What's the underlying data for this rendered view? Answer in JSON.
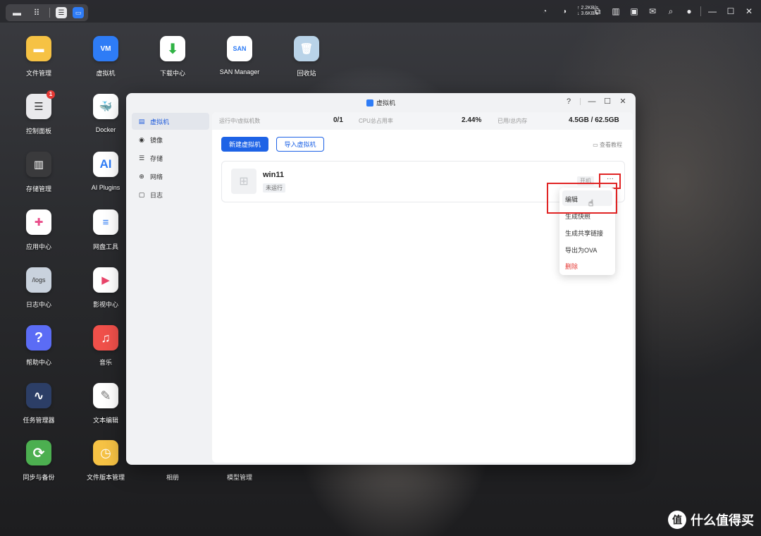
{
  "topbar": {
    "net_up": "↑ 2.2KB/s",
    "net_down": "↓ 3.6KB/s",
    "icons": [
      "desktop-icon",
      "apps-grid-icon",
      "control-panel-icon",
      "vm-app-icon",
      "cpu-icon",
      "ram-icon",
      "widget-icon",
      "notes-icon",
      "monitor-icon",
      "messages-icon",
      "search-icon",
      "user-icon",
      "minimize-icon",
      "maximize-icon",
      "close-icon"
    ]
  },
  "desktop": {
    "apps": [
      {
        "label": "文件管理",
        "color": "#f6c244",
        "glyph": "▬"
      },
      {
        "label": "虚拟机",
        "color": "#2e7cf6",
        "glyph": "VM"
      },
      {
        "label": "下载中心",
        "color": "#ffffff",
        "glyph": "⬇"
      },
      {
        "label": "SAN Manager",
        "color": "#ffffff",
        "glyph": "SAN"
      },
      {
        "label": "回收站",
        "color": "#b9d3e8",
        "glyph": "🗑"
      },
      {
        "label": "控制面板",
        "color": "#e9e9ec",
        "glyph": "☰",
        "badge": "1"
      },
      {
        "label": "Docker",
        "color": "#ffffff",
        "glyph": "🐳"
      },
      {
        "label": "存储管理",
        "color": "#3a3a3c",
        "glyph": "▥"
      },
      {
        "label": "AI Plugins",
        "color": "#ffffff",
        "glyph": "AI"
      },
      {
        "label": "应用中心",
        "color": "#ffffff",
        "glyph": "✚"
      },
      {
        "label": "网盘工具",
        "color": "#ffffff",
        "glyph": "≡"
      },
      {
        "label": "日志中心",
        "color": "#c9d2dd",
        "glyph": "/logs"
      },
      {
        "label": "影视中心",
        "color": "#ffffff",
        "glyph": "▶"
      },
      {
        "label": "帮助中心",
        "color": "#5b6cf5",
        "glyph": "?"
      },
      {
        "label": "音乐",
        "color": "#f0504a",
        "glyph": "♫"
      },
      {
        "label": "任务管理器",
        "color": "#2c3e66",
        "glyph": "∿"
      },
      {
        "label": "文本编辑",
        "color": "#ffffff",
        "glyph": "✎"
      },
      {
        "label": "同步与备份",
        "color": "#4caf50",
        "glyph": "⟳"
      },
      {
        "label": "文件版本管理",
        "color": "#f6c244",
        "glyph": "◷"
      },
      {
        "label": "相册",
        "color": "",
        "glyph": ""
      },
      {
        "label": "模型管理",
        "color": "",
        "glyph": ""
      }
    ]
  },
  "window": {
    "title": "虚拟机",
    "help": "?",
    "sidebar": [
      {
        "label": "虚拟机",
        "icon": "server-icon",
        "glyph": "▤"
      },
      {
        "label": "镜像",
        "icon": "disc-icon",
        "glyph": "◉"
      },
      {
        "label": "存储",
        "icon": "database-icon",
        "glyph": "☰"
      },
      {
        "label": "网络",
        "icon": "globe-icon",
        "glyph": "⊕"
      },
      {
        "label": "日志",
        "icon": "log-icon",
        "glyph": "▢"
      }
    ],
    "stats": {
      "running_label": "运行中/虚拟机数",
      "running_value": "0/1",
      "cpu_label": "CPU总占用率",
      "cpu_value": "2.44%",
      "mem_label": "已用/总内存",
      "mem_value": "4.5GB / 62.5GB"
    },
    "actions": {
      "new_vm": "新建虚拟机",
      "import_vm": "导入虚拟机",
      "tutorial": "查看教程"
    },
    "vm": {
      "name": "win11",
      "status": "未运行",
      "start": "开机",
      "more": "···"
    },
    "context_menu": [
      "编辑",
      "生成快照",
      "生成共享链接",
      "导出为OVA",
      "删除"
    ]
  },
  "watermark": {
    "text": "什么值得买",
    "logo": "值"
  }
}
